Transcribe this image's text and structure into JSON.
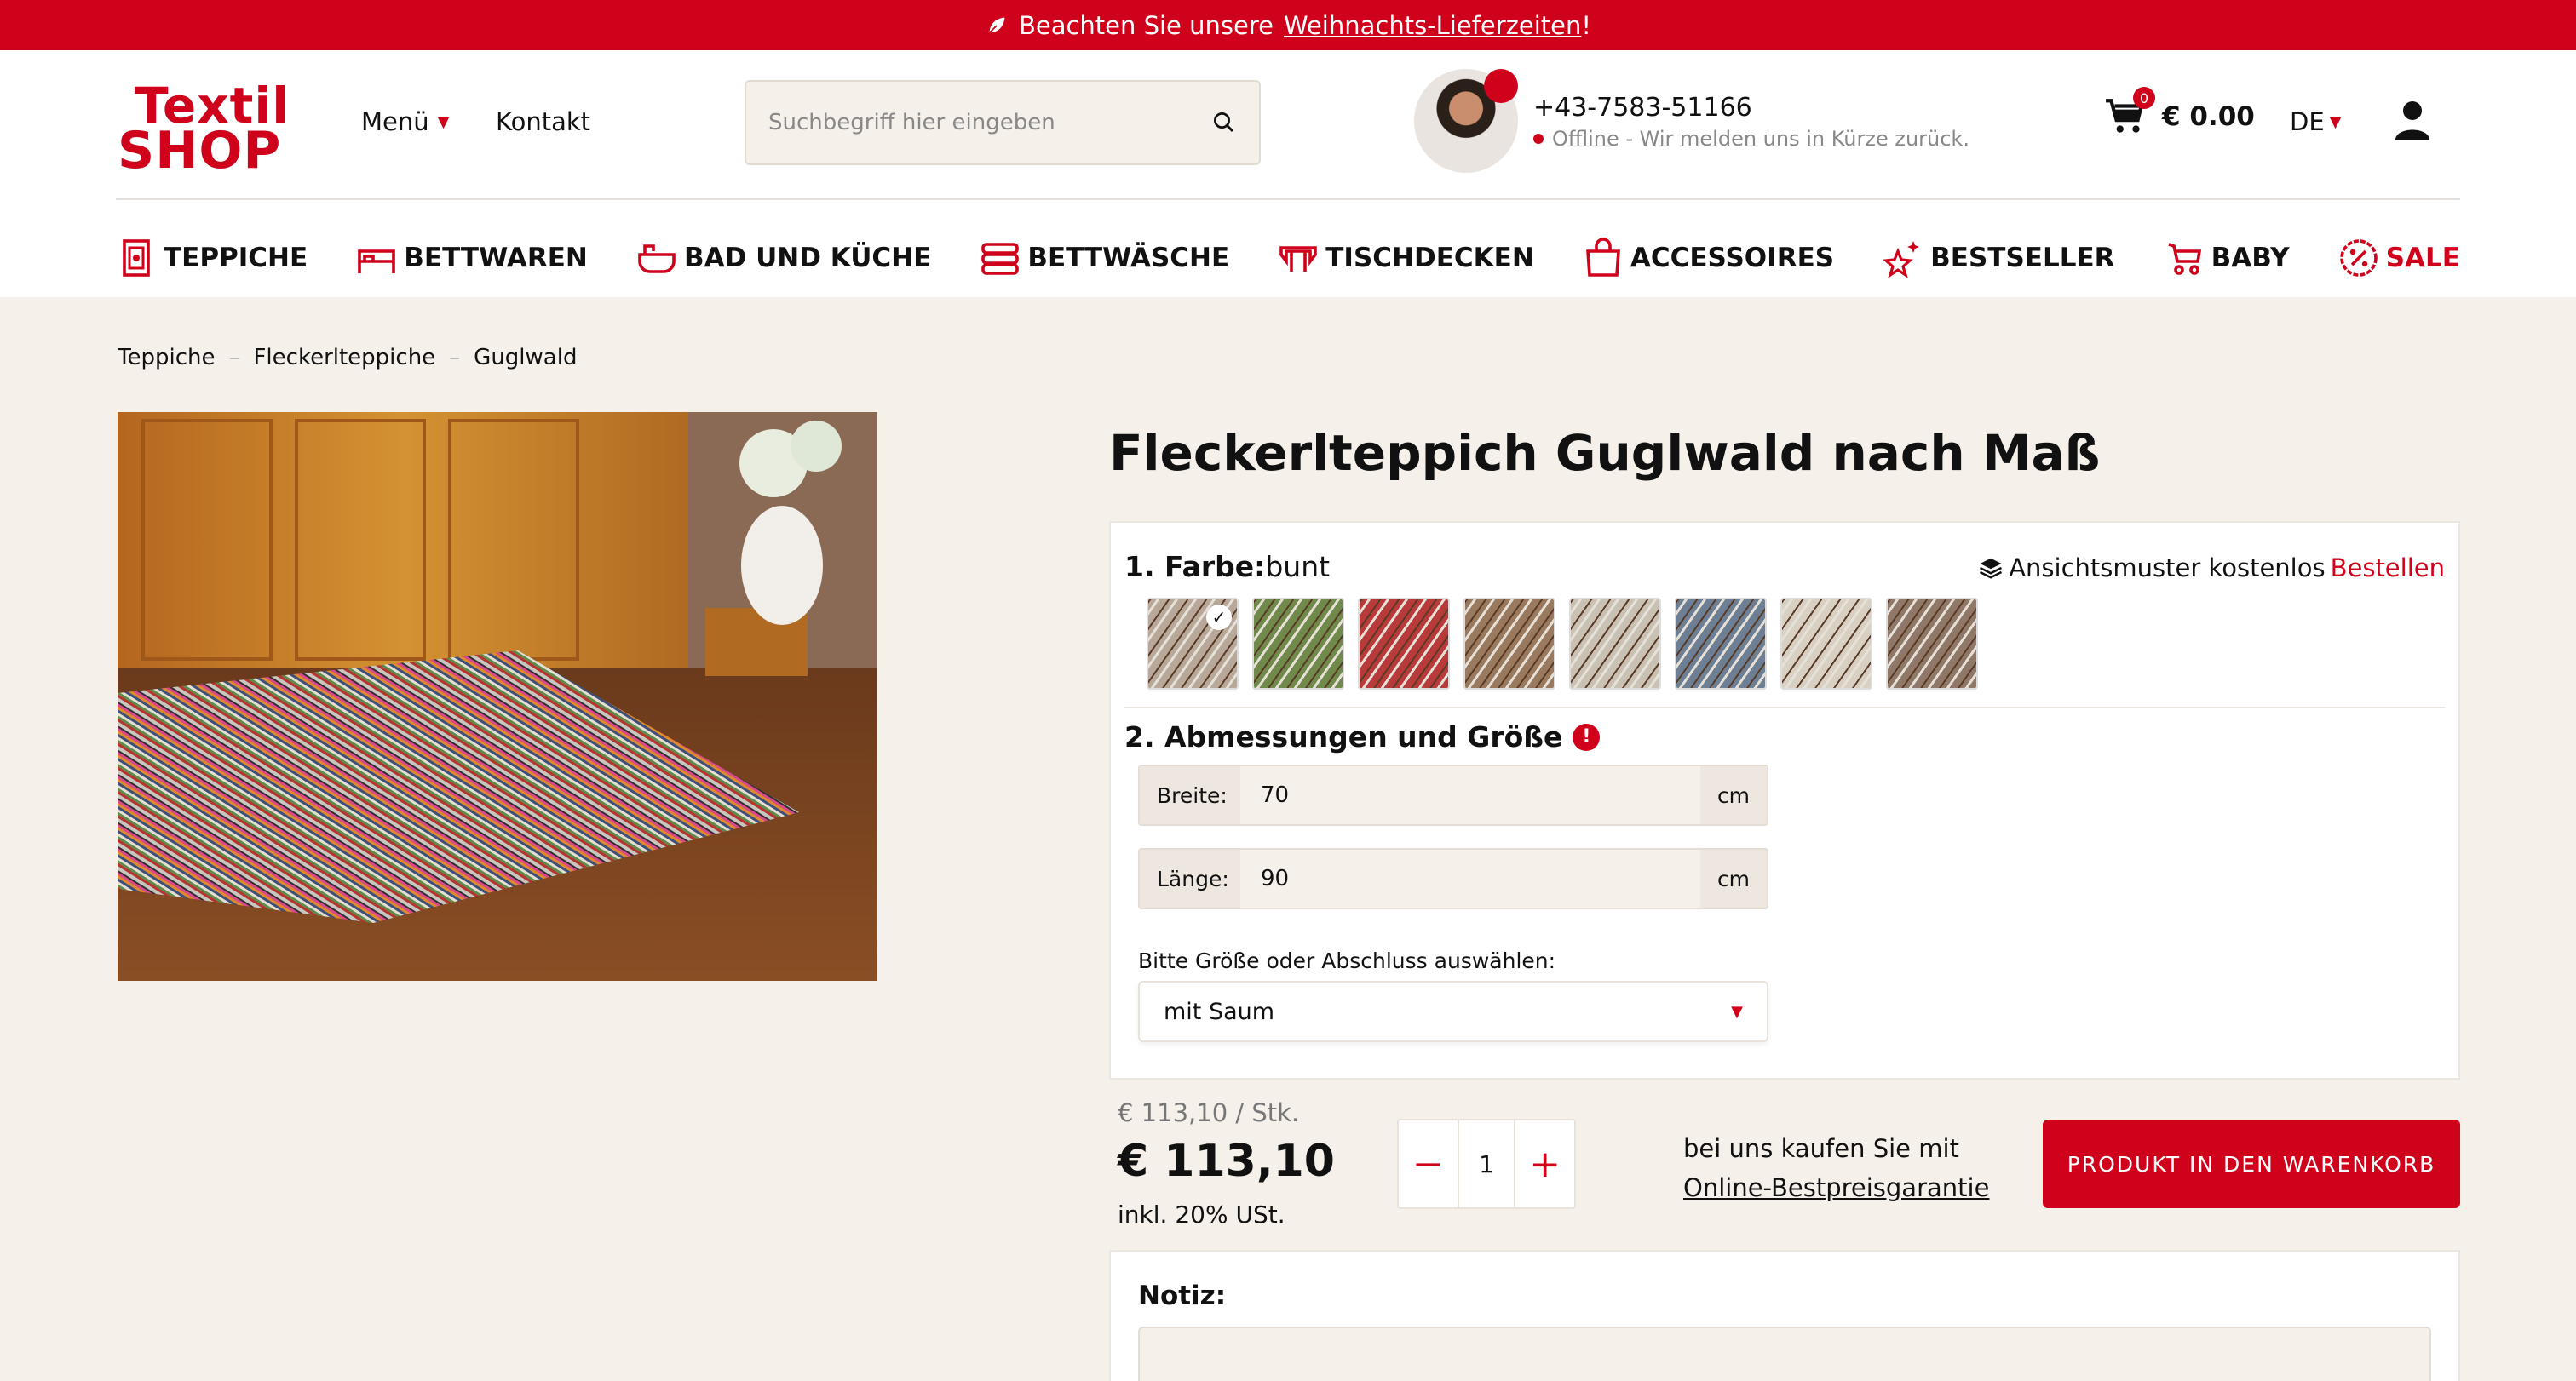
{
  "banner": {
    "text": "Beachten Sie unsere",
    "link": "Weihnachts-Lieferzeiten",
    "suffix": "!"
  },
  "logo": {
    "line1": "Textil",
    "line2": "SHOP"
  },
  "topnav": {
    "menu": "Menü",
    "contact": "Kontakt"
  },
  "search": {
    "placeholder": "Suchbegriff hier eingeben",
    "value": ""
  },
  "support": {
    "phone": "+43-7583-51166",
    "status": "Offline - Wir melden uns in Kürze zurück."
  },
  "cart": {
    "count": "0",
    "total": "€ 0.00"
  },
  "language": "DE",
  "categories": [
    {
      "label": "TEPPICHE",
      "icon": "rug-icon"
    },
    {
      "label": "BETTWAREN",
      "icon": "bed-icon"
    },
    {
      "label": "BAD UND KÜCHE",
      "icon": "bathtub-icon"
    },
    {
      "label": "BETTWÄSCHE",
      "icon": "linen-stack-icon"
    },
    {
      "label": "TISCHDECKEN",
      "icon": "tablecloth-icon"
    },
    {
      "label": "ACCESSOIRES",
      "icon": "bag-icon"
    },
    {
      "label": "BESTSELLER",
      "icon": "stars-icon"
    },
    {
      "label": "BABY",
      "icon": "stroller-icon"
    },
    {
      "label": "SALE",
      "icon": "percent-badge-icon"
    }
  ],
  "breadcrumb": [
    "Teppiche",
    "Fleckerlteppiche",
    "Guglwald"
  ],
  "product": {
    "title": "Fleckerlteppich Guglwald nach Maß",
    "color_label": "1. Farbe:",
    "color_value": "bunt",
    "sample_text": "Ansichtsmuster kostenlos",
    "sample_link": "Bestellen",
    "dimensions_label": "2. Abmessungen und Größe",
    "width_label": "Breite:",
    "width_value": "70",
    "length_label": "Länge:",
    "length_value": "90",
    "unit": "cm",
    "size_hint": "Bitte Größe oder Abschluss auswählen:",
    "finish_selected": "mit Saum",
    "unit_price": "€ 113,10 / Stk.",
    "price": "€ 113,10",
    "tax": "inkl. 20% USt.",
    "quantity": "1",
    "guarantee_text": "bei uns kaufen Sie mit",
    "guarantee_link": "Online-Bestpreisgarantie",
    "add_to_cart": "PRODUKT IN DEN WARENKORB",
    "note_label": "Notiz:"
  },
  "swatch_colors": [
    "#b7a89a",
    "#6f8a4a",
    "#b83a3a",
    "#9a7a5e",
    "#c9c1b4",
    "#6c7f94",
    "#d8d0c2",
    "#8f7868"
  ],
  "colors": {
    "accent": "#d0021b",
    "background": "#f5f0ea"
  }
}
